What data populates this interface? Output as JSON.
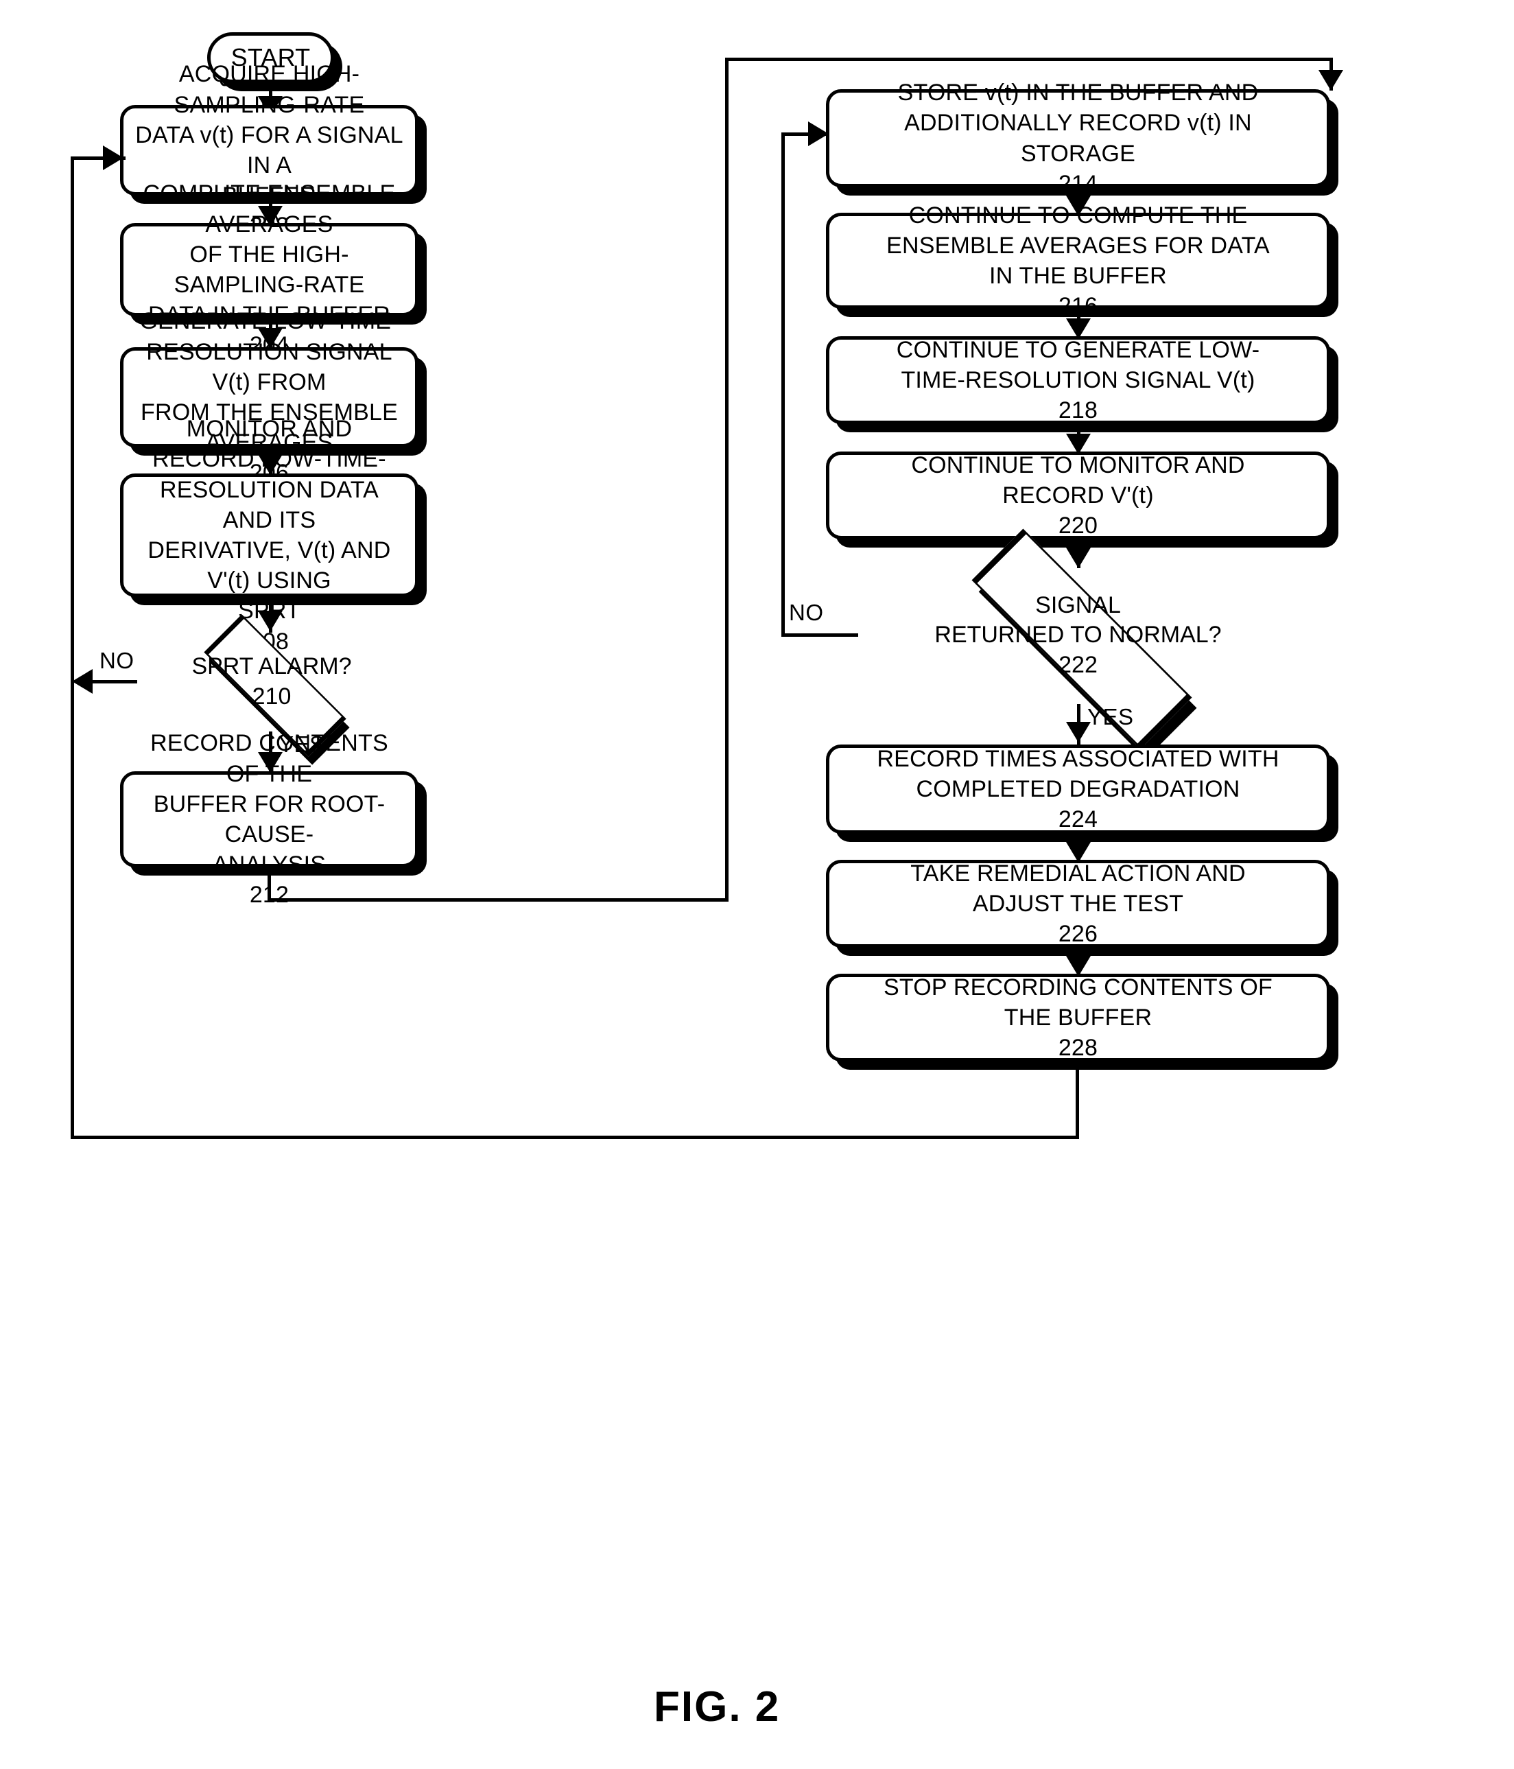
{
  "figure": {
    "caption": "FIG. 2",
    "start_label": "START"
  },
  "colors": {
    "stroke": "#000000",
    "fill": "#ffffff",
    "text": "#000000"
  },
  "nodes": {
    "n202": {
      "text": "ACQUIRE HIGH-SAMPLING-RATE\nDATA v(t) FOR A SIGNAL IN A\nBUFFER",
      "num": "202"
    },
    "n204": {
      "text": "COMPUTE ENSEMBLE AVERAGES\nOF THE HIGH-SAMPLING-RATE\nDATA IN THE BUFFER",
      "num": "204"
    },
    "n206": {
      "text": "GENERATE LOW-TIME-\nRESOLUTION SIGNAL V(t) FROM\nFROM THE ENSEMBLE AVERAGES",
      "num": "206"
    },
    "n208": {
      "text": "MONITOR AND RECORD LOW-TIME-\nRESOLUTION DATA AND ITS\nDERIVATIVE, V(t) AND V'(t) USING\nSPRT",
      "num": "208"
    },
    "n210": {
      "text": "SPRT ALARM?",
      "num": "210"
    },
    "n212": {
      "text": "RECORD CONTENTS OF THE\nBUFFER FOR ROOT-CAUSE-\nANALYSIS",
      "num": "212"
    },
    "n214": {
      "text": "STORE v(t) IN THE BUFFER AND\nADDITIONALLY RECORD v(t) IN\nSTORAGE",
      "num": "214"
    },
    "n216": {
      "text": "CONTINUE TO COMPUTE THE\nENSEMBLE AVERAGES FOR DATA\nIN THE BUFFER",
      "num": "216"
    },
    "n218": {
      "text": "CONTINUE TO GENERATE LOW-\nTIME-RESOLUTION SIGNAL V(t)",
      "num": "218"
    },
    "n220": {
      "text": "CONTINUE TO MONITOR AND\nRECORD V'(t)",
      "num": "220"
    },
    "n222": {
      "text": "SIGNAL\nRETURNED TO NORMAL?",
      "num": "222"
    },
    "n224": {
      "text": "RECORD TIMES ASSOCIATED WITH\nCOMPLETED DEGRADATION",
      "num": "224"
    },
    "n226": {
      "text": "TAKE REMEDIAL ACTION AND\nADJUST THE TEST",
      "num": "226"
    },
    "n228": {
      "text": "STOP RECORDING CONTENTS OF\nTHE BUFFER",
      "num": "228"
    }
  },
  "edge_labels": {
    "sprt_no": "NO",
    "sprt_yes": "YES",
    "normal_no": "NO",
    "normal_yes": "YES"
  }
}
